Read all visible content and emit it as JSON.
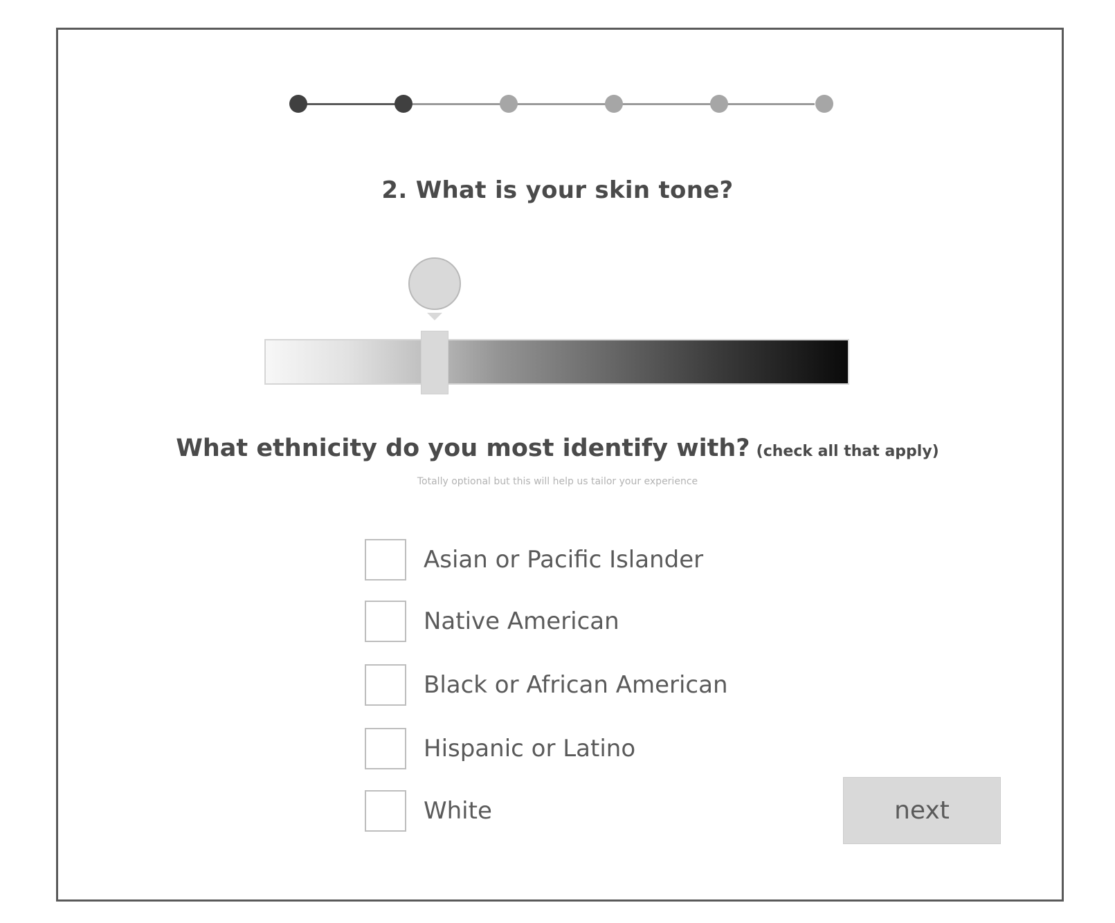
{
  "progress": {
    "total_steps": 6,
    "completed_steps": 2
  },
  "question": {
    "title": "2. What is your skin tone?"
  },
  "skin_tone_slider": {
    "value_fraction": 0.29,
    "gradient_from": "#f7f7f7",
    "gradient_to": "#0a0a0a",
    "selected_color": "#d9d9d9"
  },
  "ethnicity": {
    "title": "What ethnicity do you most identify with?",
    "hint": "(check all that apply)",
    "note": "Totally optional but this will help us tailor your experience",
    "options": [
      {
        "label": "Asian or Pacific Islander",
        "checked": false
      },
      {
        "label": "Native American",
        "checked": false
      },
      {
        "label": "Black or African American",
        "checked": false
      },
      {
        "label": "Hispanic or Latino",
        "checked": false
      },
      {
        "label": "White",
        "checked": false
      }
    ]
  },
  "actions": {
    "next_label": "next"
  }
}
